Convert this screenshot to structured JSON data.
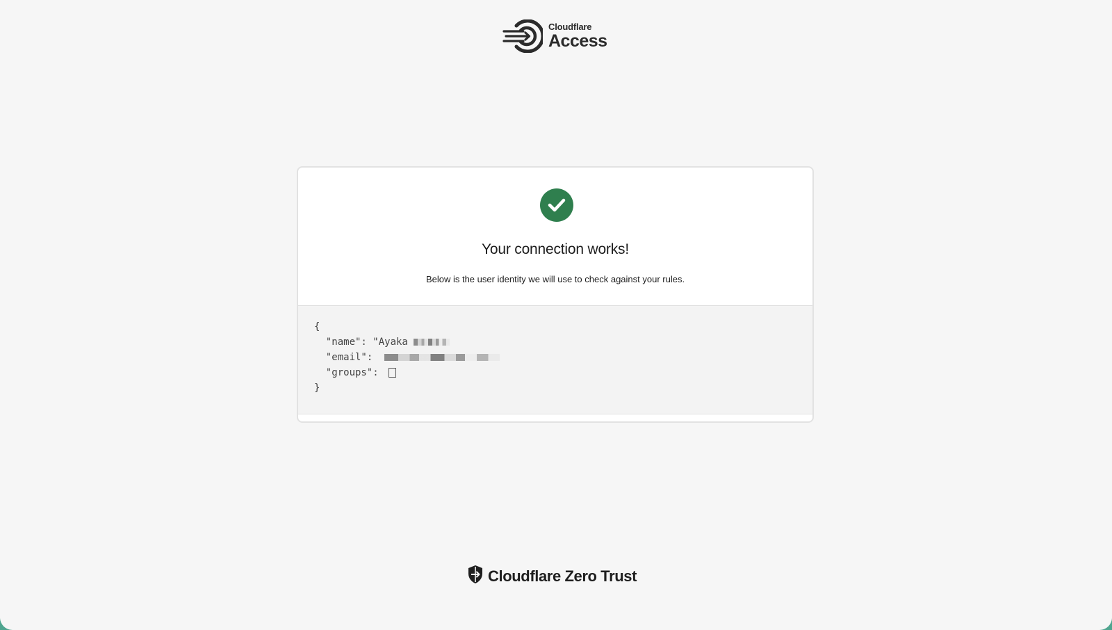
{
  "header": {
    "brand_small": "Cloudflare",
    "brand_big": "Access",
    "logo_icon": "cloudflare-access-logo-icon"
  },
  "card": {
    "status_icon": "check-circle-icon",
    "status_color": "#2f7f4e",
    "title": "Your connection works!",
    "subtitle": "Below is the user identity we will use to check against your rules.",
    "identity": {
      "open_brace": "{",
      "name_line": "  \"name\": \"Ayaka",
      "email_line": "  \"email\": ",
      "groups_line": "  \"groups\": ",
      "close_brace": "}"
    }
  },
  "footer": {
    "brand": "Cloudflare Zero Trust",
    "icon": "zero-trust-shield-icon"
  }
}
